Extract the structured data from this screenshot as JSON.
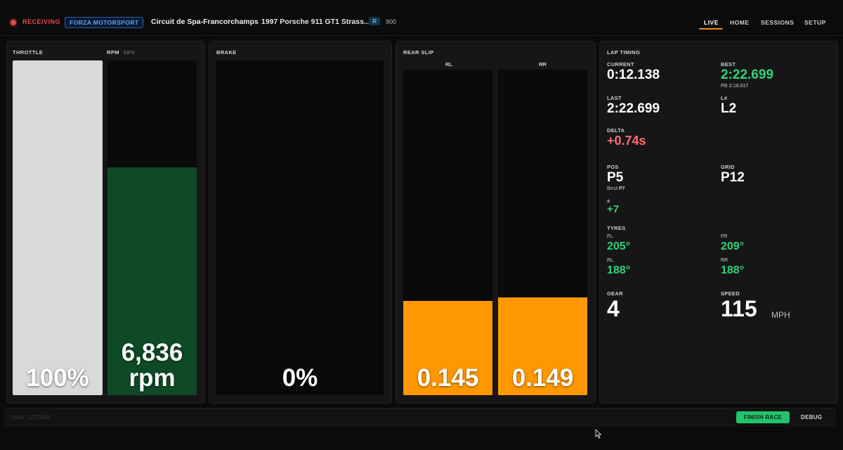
{
  "header": {
    "status": "RECEIVING",
    "game": "FORZA MOTORSPORT",
    "separator": "·",
    "track": "Circuit de Spa-Francorchamps",
    "car": "1997 Porsche 911 GT1 Strass...",
    "car_class": "R",
    "pi": "900",
    "status_color": "#e5484d"
  },
  "nav": [
    {
      "label": "LIVE",
      "active": true
    },
    {
      "label": "HOME",
      "active": false
    },
    {
      "label": "SESSIONS",
      "active": false
    },
    {
      "label": "SETUP",
      "active": false
    }
  ],
  "throttle": {
    "label": "THROTTLE",
    "value_text": "100%",
    "level": 1.0,
    "color": "#d9d9d9"
  },
  "rpm": {
    "label": "RPM",
    "percent_text": "68%",
    "value_text": "6,836",
    "unit": "rpm",
    "level": 0.68,
    "color": "#0e4a26"
  },
  "brake": {
    "label": "BRAKE",
    "value_text": "0%",
    "level": 0.0
  },
  "rear_slip": {
    "label": "REAR SLIP",
    "color": "#ff9800",
    "wheels": [
      {
        "label": "RL",
        "value_text": "0.145",
        "level": 0.29
      },
      {
        "label": "RR",
        "value_text": "0.149",
        "level": 0.3
      }
    ]
  },
  "lap_timing": {
    "title": "LAP TIMING",
    "current_label": "CURRENT",
    "current": "0:12.138",
    "best_label": "BEST",
    "best": "2:22.699",
    "pb_label": "PB",
    "pb": "2:18.017",
    "last_label": "LAST",
    "last": "2:22.699",
    "lap_label": "L#",
    "lap": "L2",
    "delta_label": "DELTA",
    "delta": "+0.74s",
    "pos_label": "POS",
    "pos": "P5",
    "pos_best_label": "Best",
    "pos_best": "P7",
    "grid_label": "GRID",
    "grid": "P12",
    "gain_label": "±",
    "gain": "+7",
    "tyres_label": "TYRES",
    "tyres": {
      "fl_label": "FL",
      "fl": "205°",
      "fr_label": "FR",
      "fr": "209°",
      "rl_label": "RL",
      "rl": "188°",
      "rr_label": "RR",
      "rr": "188°"
    },
    "gear_label": "GEAR",
    "gear": "4",
    "speed_label": "SPEED",
    "speed": "115",
    "speed_unit": "MPH"
  },
  "footer": {
    "note": "hash: 12239dA",
    "finish_label": "FINISH RACE",
    "debug_label": "DEBUG"
  }
}
